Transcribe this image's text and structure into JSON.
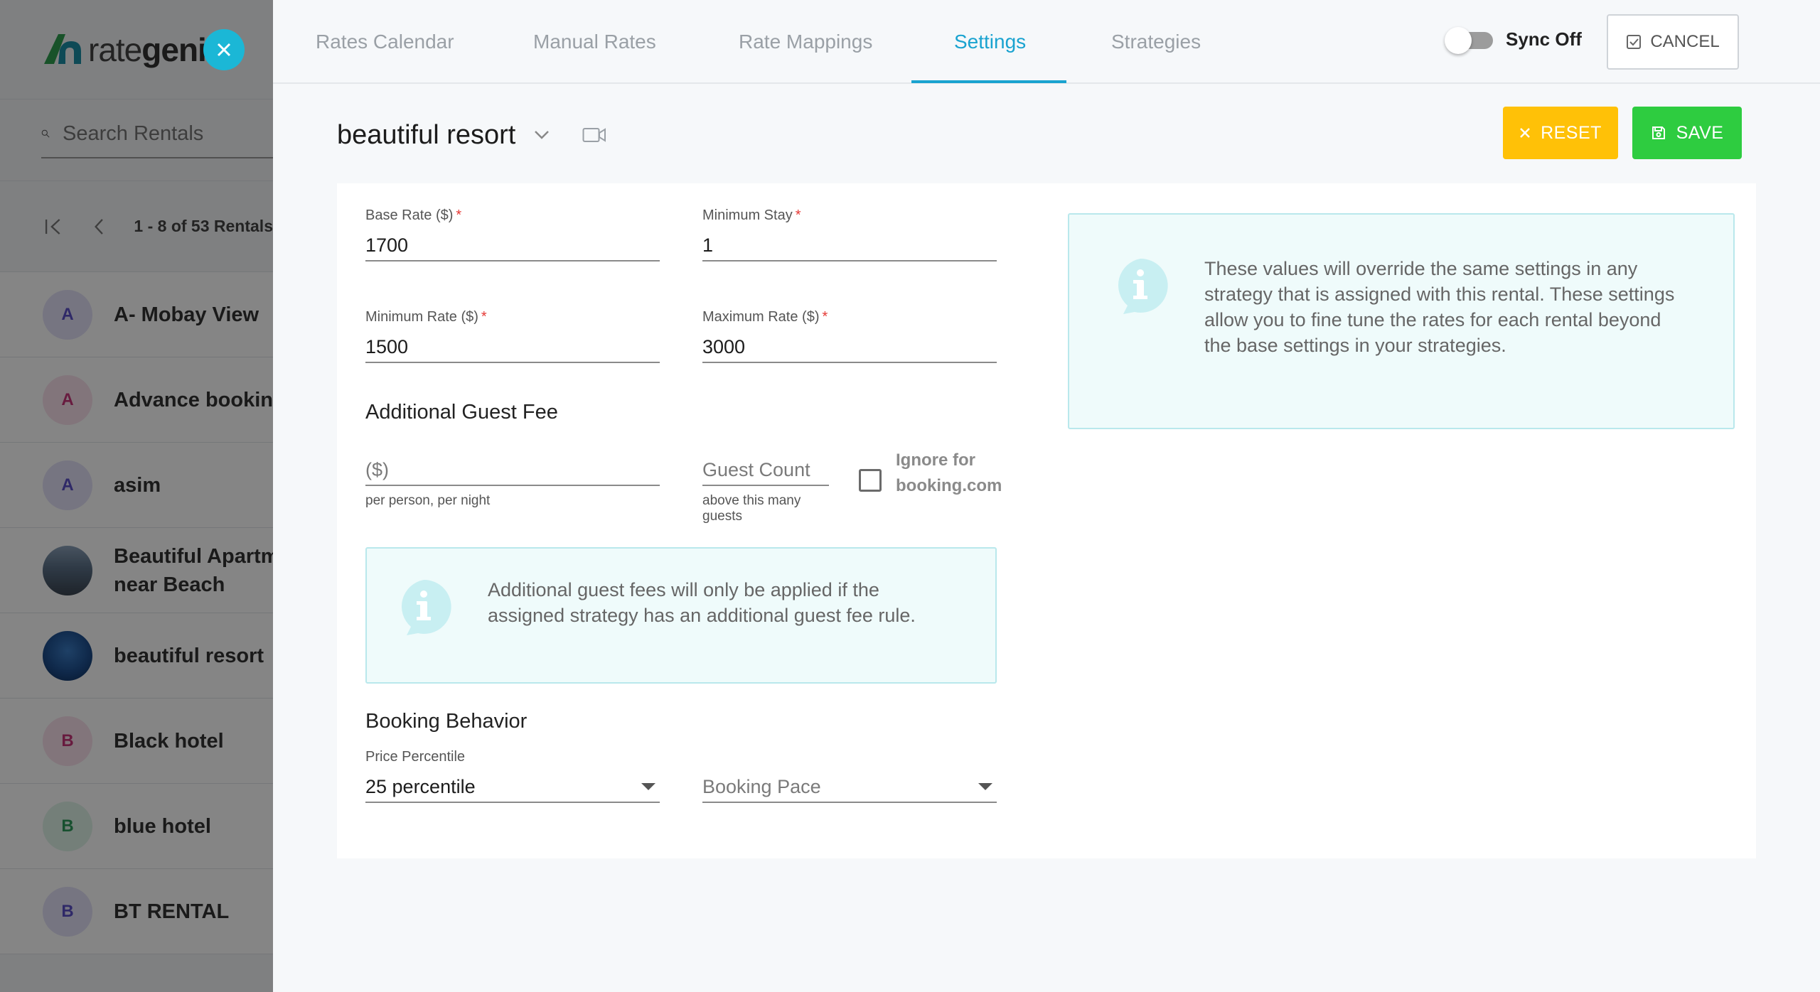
{
  "brand": {
    "logo_text_light": "rate",
    "logo_text_bold": "geni",
    "accent": "#1aa3d0",
    "logo_green": "#2e9e4f",
    "logo_teal": "#1b8fa6"
  },
  "sidebar": {
    "search_placeholder": "Search Rentals",
    "pager_text": "1 - 8 of 53 Rentals",
    "rentals": [
      {
        "initial": "A",
        "name": "A- Mobay View",
        "avatar_bg": "#e3e1f7",
        "avatar_fg": "#5b4fc7",
        "photo": false
      },
      {
        "initial": "A",
        "name": "Advance booking",
        "avatar_bg": "#f9e0ec",
        "avatar_fg": "#c7357a",
        "photo": false
      },
      {
        "initial": "A",
        "name": "asim",
        "avatar_bg": "#e3e1f7",
        "avatar_fg": "#5b4fc7",
        "photo": false
      },
      {
        "initial": "",
        "name_line1": "Beautiful Apartm",
        "name_line2": "near Beach",
        "photo": true
      },
      {
        "initial": "",
        "name": "beautiful resort",
        "photo": true
      },
      {
        "initial": "B",
        "name": "Black hotel",
        "avatar_bg": "#f9e0ec",
        "avatar_fg": "#c7357a",
        "photo": false
      },
      {
        "initial": "B",
        "name": "blue hotel",
        "avatar_bg": "#dff3e8",
        "avatar_fg": "#2c9a5a",
        "photo": false
      },
      {
        "initial": "B",
        "name": "BT RENTAL",
        "avatar_bg": "#e3e1f7",
        "avatar_fg": "#5b4fc7",
        "photo": false
      }
    ]
  },
  "tabs": [
    {
      "label": "Rates Calendar",
      "active": false
    },
    {
      "label": "Manual Rates",
      "active": false
    },
    {
      "label": "Rate Mappings",
      "active": false
    },
    {
      "label": "Settings",
      "active": true
    },
    {
      "label": "Strategies",
      "active": false
    }
  ],
  "header": {
    "sync_label": "Sync Off",
    "sync_on": false,
    "cancel_label": "CANCEL"
  },
  "rental": {
    "title": "beautiful resort",
    "reset_label": "RESET",
    "save_label": "SAVE",
    "reset_color": "#ffc107",
    "save_color": "#2ecc40"
  },
  "form": {
    "base_rate": {
      "label": "Base Rate ($)",
      "required": "*",
      "value": "1700"
    },
    "min_stay": {
      "label": "Minimum Stay",
      "required": "*",
      "value": "1"
    },
    "min_rate": {
      "label": "Minimum Rate ($)",
      "required": "*",
      "value": "1500"
    },
    "max_rate": {
      "label": "Maximum Rate ($)",
      "required": "*",
      "value": "3000"
    },
    "guest_fee_section": "Additional Guest Fee",
    "guest_fee": {
      "placeholder": "($)",
      "hint": "per person, per night"
    },
    "guest_count": {
      "placeholder": "Guest Count",
      "hint_line1": "above this many",
      "hint_line2": "guests"
    },
    "ignore_booking": {
      "line1": "Ignore for",
      "line2": "booking.com",
      "checked": false
    },
    "guest_fee_info": "Additional guest fees will only be applied if the assigned strategy has an additional guest fee rule.",
    "booking_section": "Booking Behavior",
    "price_percentile": {
      "label": "Price Percentile",
      "value": "25 percentile"
    },
    "booking_pace": {
      "placeholder": "Booking Pace"
    }
  },
  "override_info": "These values will override the same settings in any strategy that is assigned with this rental. These settings allow you to fine tune the rates for each rental beyond the base settings in your strategies."
}
